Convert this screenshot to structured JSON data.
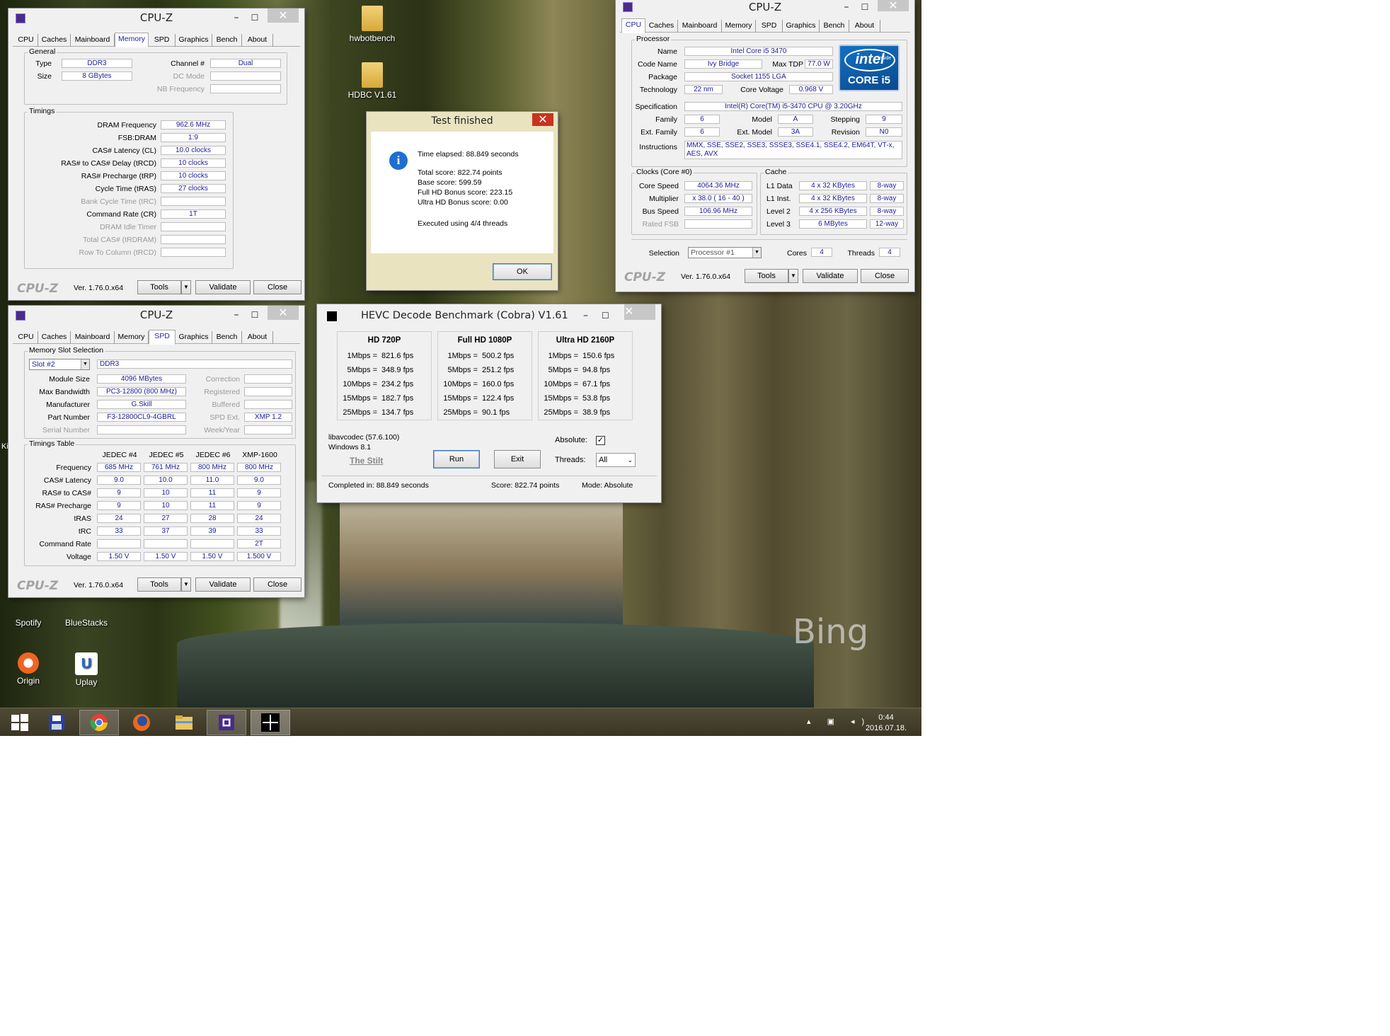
{
  "desktop": {
    "icons": [
      {
        "label": "hwbotbench",
        "kind": "folder"
      },
      {
        "label": "HDBC V1.61",
        "kind": "folder"
      },
      {
        "label": "Spotify",
        "kind": "app"
      },
      {
        "label": "BlueStacks",
        "kind": "app"
      },
      {
        "label": "Origin",
        "kind": "app"
      },
      {
        "label": "Uplay",
        "kind": "app"
      }
    ],
    "watermark": "Bing",
    "partial_icon_text": "Ki"
  },
  "taskbar": {
    "time": "0:44",
    "date": "2016.07.18.",
    "apps": [
      "start",
      "save",
      "chrome",
      "firefox",
      "explorer",
      "cpu-z",
      "hevc"
    ]
  },
  "cpuz_memory": {
    "title": "CPU-Z",
    "tabs": [
      "CPU",
      "Caches",
      "Mainboard",
      "Memory",
      "SPD",
      "Graphics",
      "Bench",
      "About"
    ],
    "selected_tab": "Memory",
    "general": {
      "group": "General",
      "type_label": "Type",
      "type": "DDR3",
      "channel_label": "Channel #",
      "channel": "Dual",
      "size_label": "Size",
      "size": "8 GBytes",
      "dcmode_label": "DC Mode",
      "nbfreq_label": "NB Frequency"
    },
    "timings": {
      "group": "Timings",
      "rows": [
        {
          "label": "DRAM Frequency",
          "value": "962.6 MHz",
          "dim": false
        },
        {
          "label": "FSB:DRAM",
          "value": "1:9",
          "dim": false
        },
        {
          "label": "CAS# Latency (CL)",
          "value": "10.0 clocks",
          "dim": false
        },
        {
          "label": "RAS# to CAS# Delay (tRCD)",
          "value": "10 clocks",
          "dim": false
        },
        {
          "label": "RAS# Precharge (tRP)",
          "value": "10 clocks",
          "dim": false
        },
        {
          "label": "Cycle Time (tRAS)",
          "value": "27 clocks",
          "dim": false
        },
        {
          "label": "Bank Cycle Time (tRC)",
          "value": "",
          "dim": true
        },
        {
          "label": "Command Rate (CR)",
          "value": "1T",
          "dim": false
        },
        {
          "label": "DRAM Idle Timer",
          "value": "",
          "dim": true
        },
        {
          "label": "Total CAS# (tRDRAM)",
          "value": "",
          "dim": true
        },
        {
          "label": "Row To Column (tRCD)",
          "value": "",
          "dim": true
        }
      ]
    },
    "footer": {
      "logo": "CPU-Z",
      "version": "Ver. 1.76.0.x64",
      "tools": "Tools",
      "validate": "Validate",
      "close": "Close"
    }
  },
  "cpuz_spd": {
    "title": "CPU-Z",
    "tabs": [
      "CPU",
      "Caches",
      "Mainboard",
      "Memory",
      "SPD",
      "Graphics",
      "Bench",
      "About"
    ],
    "selected_tab": "SPD",
    "slot_group": "Memory Slot Selection",
    "slot": "Slot #2",
    "mem_type": "DDR3",
    "left_rows": [
      {
        "label": "Module Size",
        "value": "4096 MBytes",
        "dim": false
      },
      {
        "label": "Max Bandwidth",
        "value": "PC3-12800 (800 MHz)",
        "dim": false
      },
      {
        "label": "Manufacturer",
        "value": "G.Skill",
        "dim": false
      },
      {
        "label": "Part Number",
        "value": "F3-12800CL9-4GBRL",
        "dim": false
      },
      {
        "label": "Serial Number",
        "value": "",
        "dim": true
      }
    ],
    "right_rows": [
      {
        "label": "Correction",
        "value": ""
      },
      {
        "label": "Registered",
        "value": ""
      },
      {
        "label": "Buffered",
        "value": ""
      },
      {
        "label": "SPD Ext.",
        "value": "XMP 1.2"
      },
      {
        "label": "Week/Year",
        "value": ""
      }
    ],
    "timings_group": "Timings Table",
    "columns": [
      "JEDEC #4",
      "JEDEC #5",
      "JEDEC #6",
      "XMP-1600"
    ],
    "rows": [
      {
        "label": "Frequency",
        "values": [
          "685 MHz",
          "761 MHz",
          "800 MHz",
          "800 MHz"
        ]
      },
      {
        "label": "CAS# Latency",
        "values": [
          "9.0",
          "10.0",
          "11.0",
          "9.0"
        ]
      },
      {
        "label": "RAS# to CAS#",
        "values": [
          "9",
          "10",
          "11",
          "9"
        ]
      },
      {
        "label": "RAS# Precharge",
        "values": [
          "9",
          "10",
          "11",
          "9"
        ]
      },
      {
        "label": "tRAS",
        "values": [
          "24",
          "27",
          "28",
          "24"
        ]
      },
      {
        "label": "tRC",
        "values": [
          "33",
          "37",
          "39",
          "33"
        ]
      },
      {
        "label": "Command Rate",
        "values": [
          "",
          "",
          "",
          "2T"
        ]
      },
      {
        "label": "Voltage",
        "values": [
          "1.50 V",
          "1.50 V",
          "1.50 V",
          "1.500 V"
        ]
      }
    ],
    "footer": {
      "logo": "CPU-Z",
      "version": "Ver. 1.76.0.x64",
      "tools": "Tools",
      "validate": "Validate",
      "close": "Close"
    }
  },
  "cpuz_cpu": {
    "title": "CPU-Z",
    "tabs": [
      "CPU",
      "Caches",
      "Mainboard",
      "Memory",
      "SPD",
      "Graphics",
      "Bench",
      "About"
    ],
    "selected_tab": "CPU",
    "processor_group": "Processor",
    "name_label": "Name",
    "name": "Intel Core i5 3470",
    "codename_label": "Code Name",
    "codename": "Ivy Bridge",
    "tdp_label": "Max TDP",
    "tdp": "77.0 W",
    "package_label": "Package",
    "package": "Socket 1155 LGA",
    "tech_label": "Technology",
    "tech": "22 nm",
    "voltage_label": "Core Voltage",
    "voltage": "0.968 V",
    "spec_label": "Specification",
    "spec": "Intel(R) Core(TM) i5-3470 CPU @ 3.20GHz",
    "family_label": "Family",
    "family": "6",
    "model_label": "Model",
    "model": "A",
    "stepping_label": "Stepping",
    "stepping": "9",
    "extfamily_label": "Ext. Family",
    "extfamily": "6",
    "extmodel_label": "Ext. Model",
    "extmodel": "3A",
    "revision_label": "Revision",
    "revision": "N0",
    "instr_label": "Instructions",
    "instructions": "MMX, SSE, SSE2, SSE3, SSSE3, SSE4.1, SSE4.2, EM64T, VT-x, AES, AVX",
    "logo": {
      "brand": "intel",
      "inside": "inside",
      "line": "CORE i5"
    },
    "clocks_group": "Clocks (Core #0)",
    "corespeed_label": "Core Speed",
    "corespeed": "4064.36 MHz",
    "multiplier_label": "Multiplier",
    "multiplier": "x 38.0 ( 16 - 40 )",
    "busspeed_label": "Bus Speed",
    "busspeed": "106.96 MHz",
    "ratedfsb_label": "Rated FSB",
    "cache_group": "Cache",
    "cache": [
      {
        "label": "L1 Data",
        "size": "4 x 32 KBytes",
        "way": "8-way"
      },
      {
        "label": "L1 Inst.",
        "size": "4 x 32 KBytes",
        "way": "8-way"
      },
      {
        "label": "Level 2",
        "size": "4 x 256 KBytes",
        "way": "8-way"
      },
      {
        "label": "Level 3",
        "size": "6 MBytes",
        "way": "12-way"
      }
    ],
    "selection_label": "Selection",
    "selection": "Processor #1",
    "cores_label": "Cores",
    "cores": "4",
    "threads_label": "Threads",
    "threads": "4",
    "footer": {
      "logo": "CPU-Z",
      "version": "Ver. 1.76.0.x64",
      "tools": "Tools",
      "validate": "Validate",
      "close": "Close"
    }
  },
  "dialog": {
    "title": "Test finished",
    "line1": "Time elapsed:  88.849 seconds",
    "line2": "Total score:  822.74 points",
    "line3": "Base score: 599.59",
    "line4": "Full HD Bonus score: 223.15",
    "line5": "Ultra HD Bonus score: 0.00",
    "line6": "Executed using 4/4 threads",
    "ok": "OK"
  },
  "hevc": {
    "title": "HEVC Decode Benchmark (Cobra) V1.61",
    "columns": [
      {
        "header": "HD 720P",
        "rows": [
          {
            "rate": "1Mbps =",
            "fps": "821.6 fps"
          },
          {
            "rate": "5Mbps =",
            "fps": "348.9 fps"
          },
          {
            "rate": "10Mbps =",
            "fps": "234.2 fps"
          },
          {
            "rate": "15Mbps =",
            "fps": "182.7 fps"
          },
          {
            "rate": "25Mbps =",
            "fps": "134.7 fps"
          }
        ]
      },
      {
        "header": "Full HD 1080P",
        "rows": [
          {
            "rate": "1Mbps =",
            "fps": "500.2 fps"
          },
          {
            "rate": "5Mbps =",
            "fps": "251.2 fps"
          },
          {
            "rate": "10Mbps =",
            "fps": "160.0 fps"
          },
          {
            "rate": "15Mbps =",
            "fps": "122.4 fps"
          },
          {
            "rate": "25Mbps =",
            "fps": "90.1 fps"
          }
        ]
      },
      {
        "header": "Ultra HD 2160P",
        "rows": [
          {
            "rate": "1Mbps =",
            "fps": "150.6 fps"
          },
          {
            "rate": "5Mbps =",
            "fps": "94.8 fps"
          },
          {
            "rate": "10Mbps =",
            "fps": "67.1 fps"
          },
          {
            "rate": "15Mbps =",
            "fps": "53.8 fps"
          },
          {
            "rate": "25Mbps =",
            "fps": "38.9 fps"
          }
        ]
      }
    ],
    "codec": "libavcodec (57.6.100)",
    "os": "Windows 8.1",
    "credit": "The Stilt",
    "run": "Run",
    "exit": "Exit",
    "absolute_label": "Absolute:",
    "absolute_checked": true,
    "threads_label": "Threads:",
    "threads": "All",
    "status_completed": "Completed in: 88.849 seconds",
    "status_score": "Score: 822.74 points",
    "status_mode": "Mode: Absolute"
  }
}
